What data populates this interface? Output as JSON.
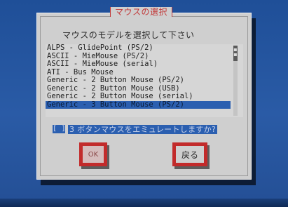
{
  "dialog": {
    "title": "マウスの選択",
    "prompt": "マウスのモデルを選択して下さい",
    "list_items": [
      "ALPS - GlidePoint (PS/2)",
      "ASCII - MieMouse (PS/2)",
      "ASCII - MieMouse (serial)",
      "ATI - Bus Mouse",
      "Generic - 2 Button Mouse (PS/2)",
      "Generic - 2 Button Mouse (USB)",
      "Generic - 2 Button Mouse (serial)",
      "Generic - 3 Button Mouse (PS/2)"
    ],
    "selected_index": 7,
    "emulate_checkbox": {
      "state": "[ ]",
      "label": "3 ボタンマウスをエミュレートしますか?"
    },
    "buttons": {
      "ok_label": "OK",
      "back_label": "戻る"
    }
  },
  "colors": {
    "desktop": "#2a5ba6",
    "dialog_bg": "#cfcfcf",
    "accent_red": "#c22b2b",
    "selection": "#2b5fb0"
  }
}
